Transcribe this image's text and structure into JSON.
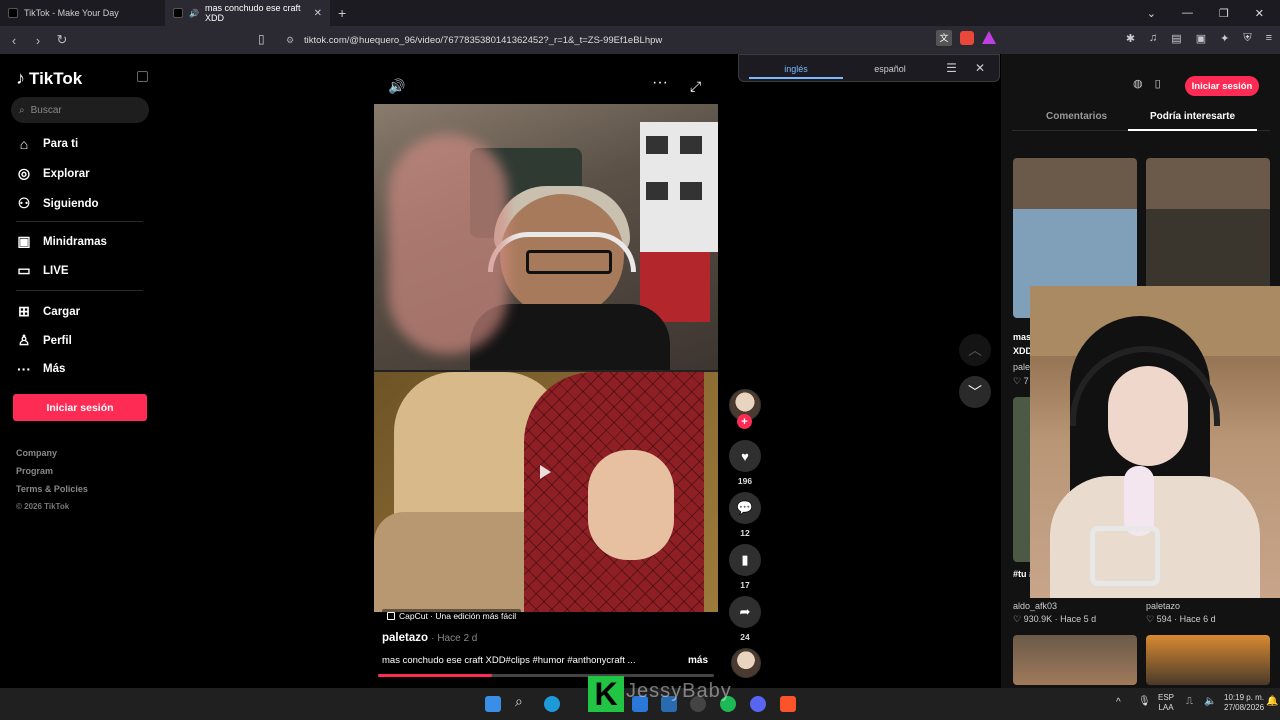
{
  "browser": {
    "tabs": [
      {
        "title": "TikTok - Make Your Day"
      },
      {
        "title": "mas conchudo ese craft XDD"
      }
    ],
    "url": "tiktok.com/@huequero_96/video/7677835380141362452?_r=1&_t=ZS-99Ef1eBLhpw"
  },
  "translate_bar": {
    "from": "inglés",
    "to": "español"
  },
  "sidebar": {
    "brand": "TikTok",
    "search_placeholder": "Buscar",
    "items": [
      {
        "label": "Para ti",
        "icon": "home-icon"
      },
      {
        "label": "Explorar",
        "icon": "compass-icon"
      },
      {
        "label": "Siguiendo",
        "icon": "following-icon"
      },
      {
        "label": "Minidramas",
        "icon": "minidramas-icon"
      },
      {
        "label": "LIVE",
        "icon": "live-icon"
      },
      {
        "label": "Cargar",
        "icon": "upload-icon"
      },
      {
        "label": "Perfil",
        "icon": "profile-icon"
      },
      {
        "label": "Más",
        "icon": "more-icon"
      }
    ],
    "login_label": "Iniciar sesión",
    "footer_links": [
      "Company",
      "Program",
      "Terms & Policies"
    ],
    "copyright": "© 2026 TikTok"
  },
  "video": {
    "watermark": "CapCut · Una edición más fácil",
    "author": "paletazo",
    "date": "· Hace 2 d",
    "caption": "mas conchudo ese craft XDD#clips #humor #anthonycraft ...",
    "more_label": "más",
    "progress_fraction": 0.34,
    "actions": {
      "likes": "196",
      "comments": "12",
      "saves": "17",
      "shares": "24"
    },
    "avatar_label": "paleta"
  },
  "right_panel": {
    "login_label": "Iniciar sesión",
    "tabs": [
      "Comentarios",
      "Podría interesarte"
    ],
    "cards": [
      {
        "author": "aldo_afk03",
        "views": "930.9K",
        "date": "Hace 5 d",
        "title_fragment": "#tu #ba"
      },
      {
        "author": "paletazo",
        "views": "594",
        "date": "Hace 6 d"
      }
    ],
    "partial_texts": [
      "mas",
      "XDD",
      "pale",
      "7"
    ]
  },
  "overlay": {
    "brand_letter": "K",
    "stream_name": "JessyBaby"
  },
  "taskbar": {
    "lang_top": "ESP",
    "lang_bottom": "LAA",
    "time": "10:19 p. m.",
    "date": "27/08/2026"
  },
  "colors": {
    "accent": "#fe2c55",
    "background": "#000000",
    "panel": "#121212"
  }
}
